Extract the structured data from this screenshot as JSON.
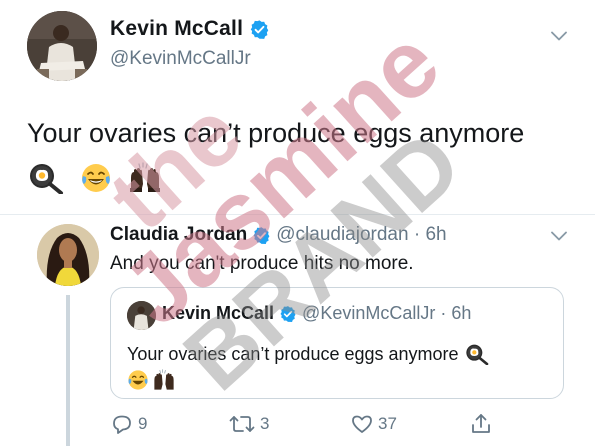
{
  "main_tweet": {
    "author_name": "Kevin McCall",
    "handle": "@KevinMcCallJr",
    "text": "Your ovaries can’t produce eggs anymore",
    "emojis": [
      "frying-pan-egg-emoji",
      "tears-of-joy-emoji",
      "raised-hands-emoji"
    ]
  },
  "reply_tweet": {
    "author_name": "Claudia Jordan",
    "handle_time": "@claudiajordan · 6h",
    "text": "And you can't produce hits no more."
  },
  "quoted_tweet": {
    "author_name": "Kevin McCall",
    "handle_time": "@KevinMcCallJr · 6h",
    "text": "Your ovaries can’t produce eggs anymore"
  },
  "actions": {
    "reply_count": "9",
    "retweet_count": "3",
    "like_count": "37"
  },
  "watermark": {
    "line1": "the",
    "line2": "Jasmine",
    "line3": "BRAND"
  },
  "colors": {
    "text_primary": "#14171a",
    "text_secondary": "#657786",
    "verified_blue": "#1da1f2",
    "divider": "#e6ecf0",
    "watermark_the": "#d89aa6",
    "watermark_jasmine": "#cf7a8c",
    "watermark_brand": "#8a8a8a"
  }
}
